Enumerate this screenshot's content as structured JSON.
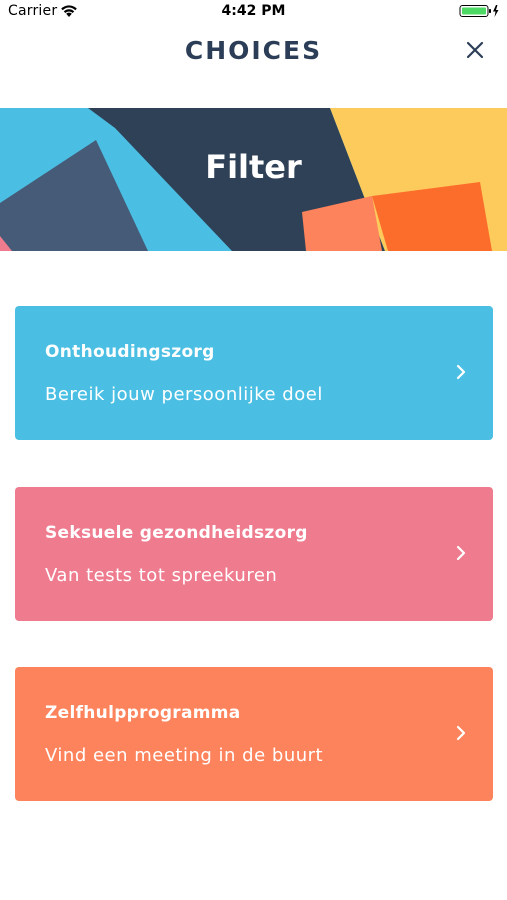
{
  "status_bar": {
    "carrier": "Carrier",
    "time": "4:42 PM",
    "wifi_icon": "wifi-icon",
    "battery_icon": "battery-charging-icon"
  },
  "nav": {
    "title": "CHOICES",
    "close_icon": "close-icon"
  },
  "banner": {
    "title": "Filter"
  },
  "cards": [
    {
      "title": "Onthoudingszorg",
      "subtitle": "Bereik jouw persoonlijke doel",
      "color": "#4bbfe3",
      "icon": "chevron-right-icon"
    },
    {
      "title": "Seksuele gezondheidszorg",
      "subtitle": "Van tests tot spreekuren",
      "color": "#ef7b8e",
      "icon": "chevron-right-icon"
    },
    {
      "title": "Zelfhulpprogramma",
      "subtitle": "Vind een meeting in de buurt",
      "color": "#fd835c",
      "icon": "chevron-right-icon"
    }
  ],
  "colors": {
    "navy": "#2c3e57",
    "sky": "#4bbfe3",
    "pink": "#ef7b8e",
    "orange": "#fd835c",
    "yellow": "#fdca5c",
    "deep_orange": "#fc6d2b"
  }
}
